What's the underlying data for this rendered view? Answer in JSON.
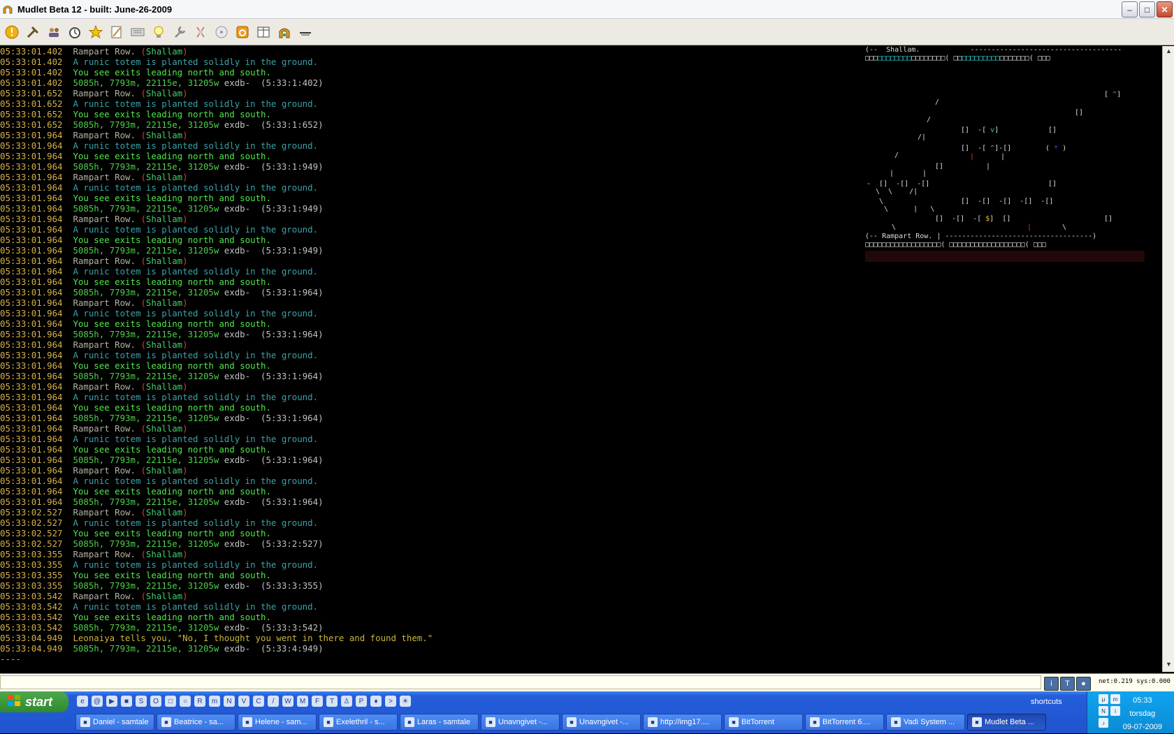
{
  "window": {
    "title": "Mudlet Beta 12 - built: June-26-2009"
  },
  "toolbar": {
    "icons": [
      "connect-icon",
      "triggers-icon",
      "aliases-icon",
      "timers-icon",
      "buttons-icon",
      "scripts-icon",
      "keys-icon",
      "variables-icon",
      "settings-icon",
      "notepad-icon",
      "help-icon",
      "replay-icon",
      "package-icon",
      "multiview-icon",
      "reconnect-icon",
      "disconnect-icon"
    ]
  },
  "console": {
    "lines": [
      {
        "ts": "05:33:01.402",
        "type": "room",
        "room": "Rampart Row.",
        "area": "Shallam"
      },
      {
        "ts": "05:33:01.402",
        "type": "desc",
        "text": "A runic totem is planted solidly in the ground."
      },
      {
        "ts": "05:33:01.402",
        "type": "exits",
        "text": "You see exits leading north and south."
      },
      {
        "ts": "05:33:01.402",
        "type": "prompt",
        "stats": "5085h, 7793m, 22115e, 31205w",
        "flags": "exdb-",
        "time": "(5:33:1:402)"
      },
      {
        "ts": "05:33:01.652",
        "type": "room",
        "room": "Rampart Row.",
        "area": "Shallam"
      },
      {
        "ts": "05:33:01.652",
        "type": "desc",
        "text": "A runic totem is planted solidly in the ground."
      },
      {
        "ts": "05:33:01.652",
        "type": "exits",
        "text": "You see exits leading north and south."
      },
      {
        "ts": "05:33:01.652",
        "type": "prompt",
        "stats": "5085h, 7793m, 22115e, 31205w",
        "flags": "exdb-",
        "time": "(5:33:1:652)"
      },
      {
        "ts": "05:33:01.964",
        "type": "room",
        "room": "Rampart Row.",
        "area": "Shallam"
      },
      {
        "ts": "05:33:01.964",
        "type": "desc",
        "text": "A runic totem is planted solidly in the ground."
      },
      {
        "ts": "05:33:01.964",
        "type": "exits",
        "text": "You see exits leading north and south."
      },
      {
        "ts": "05:33:01.964",
        "type": "prompt",
        "stats": "5085h, 7793m, 22115e, 31205w",
        "flags": "exdb-",
        "time": "(5:33:1:949)"
      },
      {
        "ts": "05:33:01.964",
        "type": "room",
        "room": "Rampart Row.",
        "area": "Shallam"
      },
      {
        "ts": "05:33:01.964",
        "type": "desc",
        "text": "A runic totem is planted solidly in the ground."
      },
      {
        "ts": "05:33:01.964",
        "type": "exits",
        "text": "You see exits leading north and south."
      },
      {
        "ts": "05:33:01.964",
        "type": "prompt",
        "stats": "5085h, 7793m, 22115e, 31205w",
        "flags": "exdb-",
        "time": "(5:33:1:949)"
      },
      {
        "ts": "05:33:01.964",
        "type": "room",
        "room": "Rampart Row.",
        "area": "Shallam"
      },
      {
        "ts": "05:33:01.964",
        "type": "desc",
        "text": "A runic totem is planted solidly in the ground."
      },
      {
        "ts": "05:33:01.964",
        "type": "exits",
        "text": "You see exits leading north and south."
      },
      {
        "ts": "05:33:01.964",
        "type": "prompt",
        "stats": "5085h, 7793m, 22115e, 31205w",
        "flags": "exdb-",
        "time": "(5:33:1:949)"
      },
      {
        "ts": "05:33:01.964",
        "type": "room",
        "room": "Rampart Row.",
        "area": "Shallam"
      },
      {
        "ts": "05:33:01.964",
        "type": "desc",
        "text": "A runic totem is planted solidly in the ground."
      },
      {
        "ts": "05:33:01.964",
        "type": "exits",
        "text": "You see exits leading north and south."
      },
      {
        "ts": "05:33:01.964",
        "type": "prompt",
        "stats": "5085h, 7793m, 22115e, 31205w",
        "flags": "exdb-",
        "time": "(5:33:1:964)"
      },
      {
        "ts": "05:33:01.964",
        "type": "room",
        "room": "Rampart Row.",
        "area": "Shallam"
      },
      {
        "ts": "05:33:01.964",
        "type": "desc",
        "text": "A runic totem is planted solidly in the ground."
      },
      {
        "ts": "05:33:01.964",
        "type": "exits",
        "text": "You see exits leading north and south."
      },
      {
        "ts": "05:33:01.964",
        "type": "prompt",
        "stats": "5085h, 7793m, 22115e, 31205w",
        "flags": "exdb-",
        "time": "(5:33:1:964)"
      },
      {
        "ts": "05:33:01.964",
        "type": "room",
        "room": "Rampart Row.",
        "area": "Shallam"
      },
      {
        "ts": "05:33:01.964",
        "type": "desc",
        "text": "A runic totem is planted solidly in the ground."
      },
      {
        "ts": "05:33:01.964",
        "type": "exits",
        "text": "You see exits leading north and south."
      },
      {
        "ts": "05:33:01.964",
        "type": "prompt",
        "stats": "5085h, 7793m, 22115e, 31205w",
        "flags": "exdb-",
        "time": "(5:33:1:964)"
      },
      {
        "ts": "05:33:01.964",
        "type": "room",
        "room": "Rampart Row.",
        "area": "Shallam"
      },
      {
        "ts": "05:33:01.964",
        "type": "desc",
        "text": "A runic totem is planted solidly in the ground."
      },
      {
        "ts": "05:33:01.964",
        "type": "exits",
        "text": "You see exits leading north and south."
      },
      {
        "ts": "05:33:01.964",
        "type": "prompt",
        "stats": "5085h, 7793m, 22115e, 31205w",
        "flags": "exdb-",
        "time": "(5:33:1:964)"
      },
      {
        "ts": "05:33:01.964",
        "type": "room",
        "room": "Rampart Row.",
        "area": "Shallam"
      },
      {
        "ts": "05:33:01.964",
        "type": "desc",
        "text": "A runic totem is planted solidly in the ground."
      },
      {
        "ts": "05:33:01.964",
        "type": "exits",
        "text": "You see exits leading north and south."
      },
      {
        "ts": "05:33:01.964",
        "type": "prompt",
        "stats": "5085h, 7793m, 22115e, 31205w",
        "flags": "exdb-",
        "time": "(5:33:1:964)"
      },
      {
        "ts": "05:33:01.964",
        "type": "room",
        "room": "Rampart Row.",
        "area": "Shallam"
      },
      {
        "ts": "05:33:01.964",
        "type": "desc",
        "text": "A runic totem is planted solidly in the ground."
      },
      {
        "ts": "05:33:01.964",
        "type": "exits",
        "text": "You see exits leading north and south."
      },
      {
        "ts": "05:33:01.964",
        "type": "prompt",
        "stats": "5085h, 7793m, 22115e, 31205w",
        "flags": "exdb-",
        "time": "(5:33:1:964)"
      },
      {
        "ts": "05:33:02.527",
        "type": "room",
        "room": "Rampart Row.",
        "area": "Shallam"
      },
      {
        "ts": "05:33:02.527",
        "type": "desc",
        "text": "A runic totem is planted solidly in the ground."
      },
      {
        "ts": "05:33:02.527",
        "type": "exits",
        "text": "You see exits leading north and south."
      },
      {
        "ts": "05:33:02.527",
        "type": "prompt",
        "stats": "5085h, 7793m, 22115e, 31205w",
        "flags": "exdb-",
        "time": "(5:33:2:527)"
      },
      {
        "ts": "05:33:03.355",
        "type": "room",
        "room": "Rampart Row.",
        "area": "Shallam"
      },
      {
        "ts": "05:33:03.355",
        "type": "desc",
        "text": "A runic totem is planted solidly in the ground."
      },
      {
        "ts": "05:33:03.355",
        "type": "exits",
        "text": "You see exits leading north and south."
      },
      {
        "ts": "05:33:03.355",
        "type": "prompt",
        "stats": "5085h, 7793m, 22115e, 31205w",
        "flags": "exdb-",
        "time": "(5:33:3:355)"
      },
      {
        "ts": "05:33:03.542",
        "type": "room",
        "room": "Rampart Row.",
        "area": "Shallam"
      },
      {
        "ts": "05:33:03.542",
        "type": "desc",
        "text": "A runic totem is planted solidly in the ground."
      },
      {
        "ts": "05:33:03.542",
        "type": "exits",
        "text": "You see exits leading north and south."
      },
      {
        "ts": "05:33:03.542",
        "type": "prompt",
        "stats": "5085h, 7793m, 22115e, 31205w",
        "flags": "exdb-",
        "time": "(5:33:3:542)"
      },
      {
        "ts": "05:33:04.949",
        "type": "tell",
        "text": "Leonaiya tells you, \"No, I thought you went in there and found them.\""
      },
      {
        "ts": "05:33:04.949",
        "type": "prompt",
        "stats": "5085h, 7793m, 22115e, 31205w",
        "flags": "exdb-",
        "time": "(5:33:4:949)"
      }
    ],
    "cursor_line": "----"
  },
  "map": {
    "header": "(--  Shallam.",
    "footer": "(-- Rampart Row. | -----------------------------------)",
    "here_symbol": "$"
  },
  "input": {
    "net_info": "net:0.219 sys:0.000"
  },
  "taskbar": {
    "start_label": "start",
    "shortcuts_label": "shortcuts",
    "tasks": [
      {
        "label": "Daniel - samtale",
        "icon": "chat-icon",
        "active": false
      },
      {
        "label": "Beatrice - sa...",
        "icon": "chat-icon",
        "active": false
      },
      {
        "label": "Helene - sam...",
        "icon": "chat-icon",
        "active": false
      },
      {
        "label": "Exelethril - s...",
        "icon": "chat-icon",
        "active": false
      },
      {
        "label": "Laras - samtale",
        "icon": "chat-icon",
        "active": false
      },
      {
        "label": "Unavngivet -...",
        "icon": "paint-icon",
        "active": false
      },
      {
        "label": "Unavngivet -...",
        "icon": "paint-icon",
        "active": false
      },
      {
        "label": "http://img17....",
        "icon": "browser-icon",
        "active": false
      },
      {
        "label": "BitTorrent",
        "icon": "folder-icon",
        "active": false
      },
      {
        "label": "BitTorrent 6....",
        "icon": "torrent-icon",
        "active": false
      },
      {
        "label": "Vadi System ...",
        "icon": "vadi-icon",
        "active": false
      },
      {
        "label": "Mudlet Beta ...",
        "icon": "mudlet-icon",
        "active": true
      }
    ],
    "clock": {
      "time": "05:33",
      "day": "torsdag",
      "date": "09-07-2009"
    }
  }
}
